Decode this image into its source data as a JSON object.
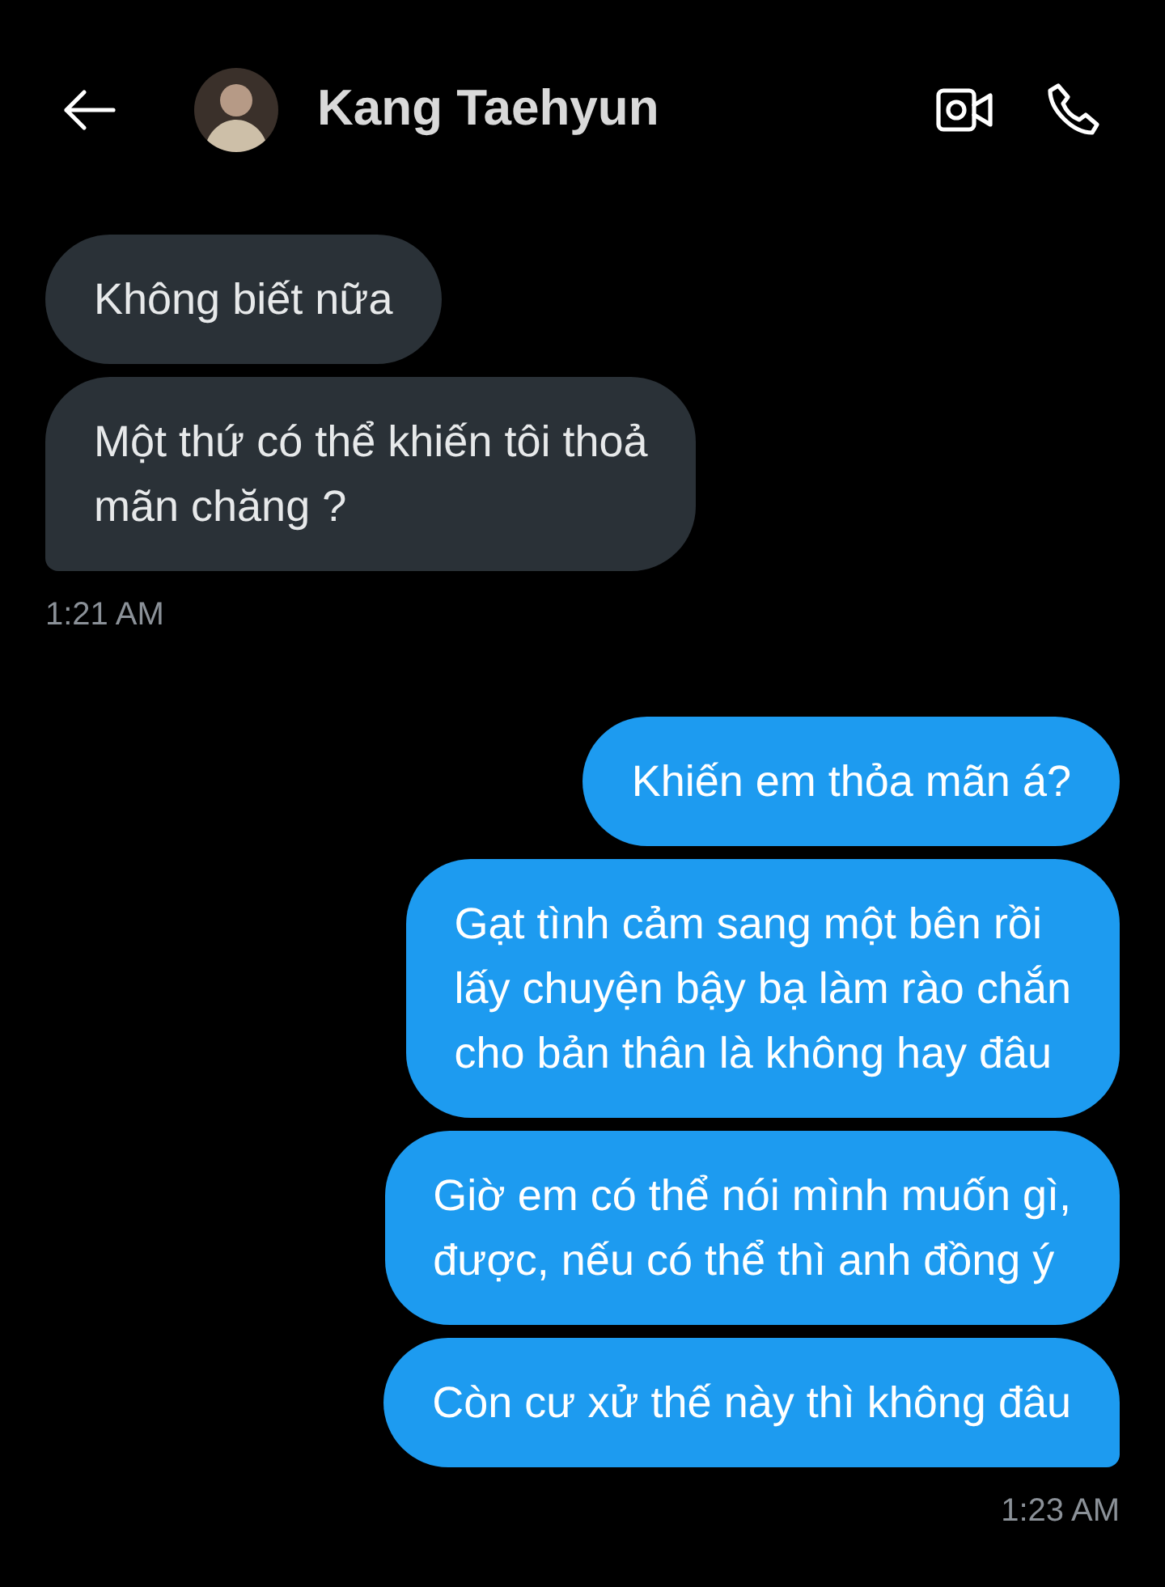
{
  "header": {
    "name": "Kang Taehyun"
  },
  "groups": [
    {
      "kind": "incoming",
      "time": "1:21 AM",
      "messages": [
        {
          "lines": [
            "Không biết nữa"
          ]
        },
        {
          "lines": [
            "Một thứ có thể khiến tôi thoả",
            "mãn chăng ?"
          ]
        }
      ]
    },
    {
      "kind": "outgoing",
      "time": "1:23 AM",
      "messages": [
        {
          "lines": [
            "Khiến em thỏa mãn á?"
          ]
        },
        {
          "lines": [
            "Gạt tình cảm sang một bên rồi",
            "lấy chuyện bậy bạ làm rào chắn",
            "cho bản thân là không hay đâu"
          ]
        },
        {
          "lines": [
            "Giờ em có thể nói mình muốn gì,",
            "được, nếu có thể thì anh đồng ý"
          ]
        },
        {
          "lines": [
            "Còn cư xử thế này thì không đâu"
          ]
        }
      ]
    }
  ]
}
